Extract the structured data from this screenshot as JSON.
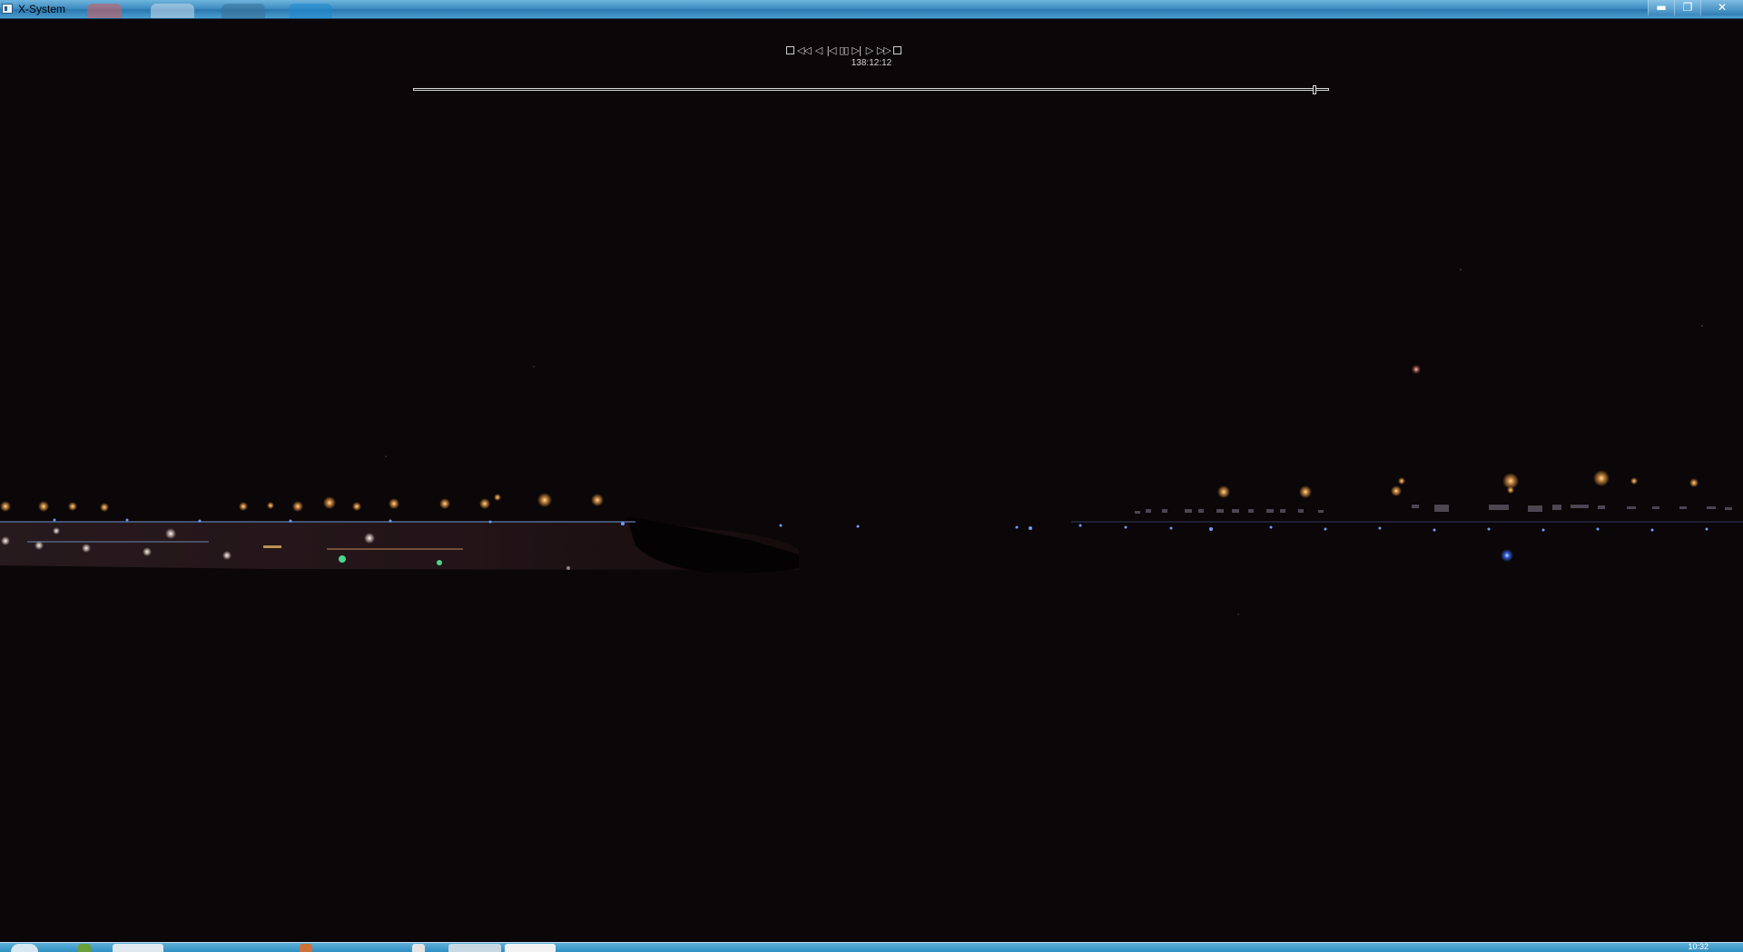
{
  "window": {
    "title": "X-System",
    "controls": {
      "minimize": "▬",
      "restore": "❐",
      "close": "✕"
    }
  },
  "playback": {
    "buttons": {
      "stop_left": "",
      "rewind_fast": "◁◁",
      "step_back": "◁",
      "skip_start": "|◁",
      "pause": "▯▯",
      "skip_end": "▷|",
      "play": "▷",
      "forward_fast": "▷▷",
      "stop_right": ""
    },
    "timecode": "138:12:12",
    "position_fraction": 0.985
  },
  "taskbar": {
    "clock": "10:32"
  },
  "colors": {
    "titlebar": "#3f8fc4",
    "background": "#0b0607",
    "control_text": "#cfcfd2",
    "taskbar": "#2f8fc2"
  }
}
